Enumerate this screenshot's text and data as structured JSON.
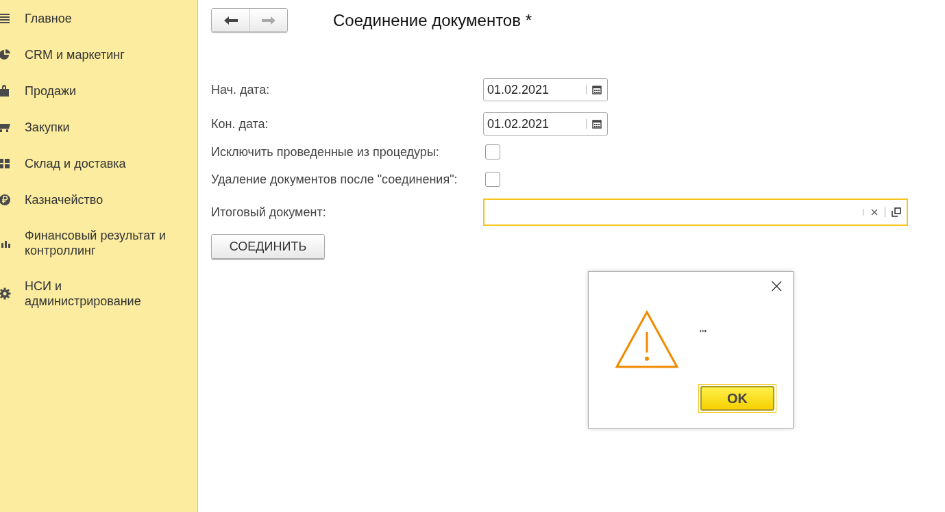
{
  "sidebar": {
    "items": [
      {
        "label": "Главное",
        "kind": "menu"
      },
      {
        "label": "CRM и маркетинг",
        "kind": "pie"
      },
      {
        "label": "Продажи",
        "kind": "bag"
      },
      {
        "label": "Закупки",
        "kind": "cart"
      },
      {
        "label": "Склад и доставка",
        "kind": "grid"
      },
      {
        "label": "Казначейство",
        "kind": "ruble"
      },
      {
        "label": "Финансовый результат и контроллинг",
        "kind": "chart"
      },
      {
        "label": "НСИ и администрирование",
        "kind": "gear"
      }
    ]
  },
  "form": {
    "title": "Соединение документов *",
    "fields": [
      {
        "kind": "date",
        "label": "Нач. дата:",
        "value": "01.02.2021"
      },
      {
        "kind": "date",
        "label": "Кон. дата:",
        "value": "01.02.2021"
      },
      {
        "kind": "checkbox",
        "label": "Исключить проведенные из процедуры:",
        "checked": false
      },
      {
        "kind": "checkbox",
        "label": "Удаление документов после \"соединения\":",
        "checked": false
      },
      {
        "kind": "ref",
        "label": "Итоговый документ:"
      }
    ],
    "button": "СОЕДИНИТЬ"
  },
  "dialog": {
    "message": "\"\"",
    "close": "×",
    "button": "OK"
  }
}
